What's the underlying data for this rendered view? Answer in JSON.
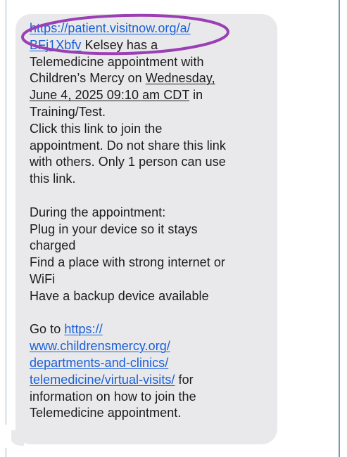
{
  "message": {
    "paragraph1": {
      "link_part1": "https://patient.visitnow.org/a/",
      "link_part2": "BFj1Xbfv",
      "text1": " Kelsey  has a",
      "line3": "Telemedicine appointment with",
      "line4_text": "Children’s Mercy on ",
      "date_part1": "Wednesday,",
      "date_part2": "June 4, 2025 09:10 am CDT",
      "line5_suffix": " in",
      "line6": "Training/Test.",
      "line7": "Click this link to join the",
      "line8": "appointment. Do not share this link",
      "line9": "with others. Only 1 person can use",
      "line10": "this link."
    },
    "paragraph2": {
      "line1": "During the appointment:",
      "line2": "Plug in your device so it stays",
      "line3": "charged",
      "line4": "Find a place with strong internet or",
      "line5": "WiFi",
      "line6": "Have a backup device available"
    },
    "paragraph3": {
      "prefix": "Go to ",
      "link_part1": "https://",
      "link_part2": "www.childrensmercy.org/",
      "link_part3": "departments-and-clinics/",
      "link_part4": "telemedicine/virtual-visits/",
      "suffix": " for",
      "line6": "information on how to join the",
      "line7": "Telemedicine appointment."
    }
  },
  "colors": {
    "bubble": "#e9e9eb",
    "link": "#1a5fd8",
    "annotation": "#9b3fb5",
    "text": "#1c1c1e"
  }
}
